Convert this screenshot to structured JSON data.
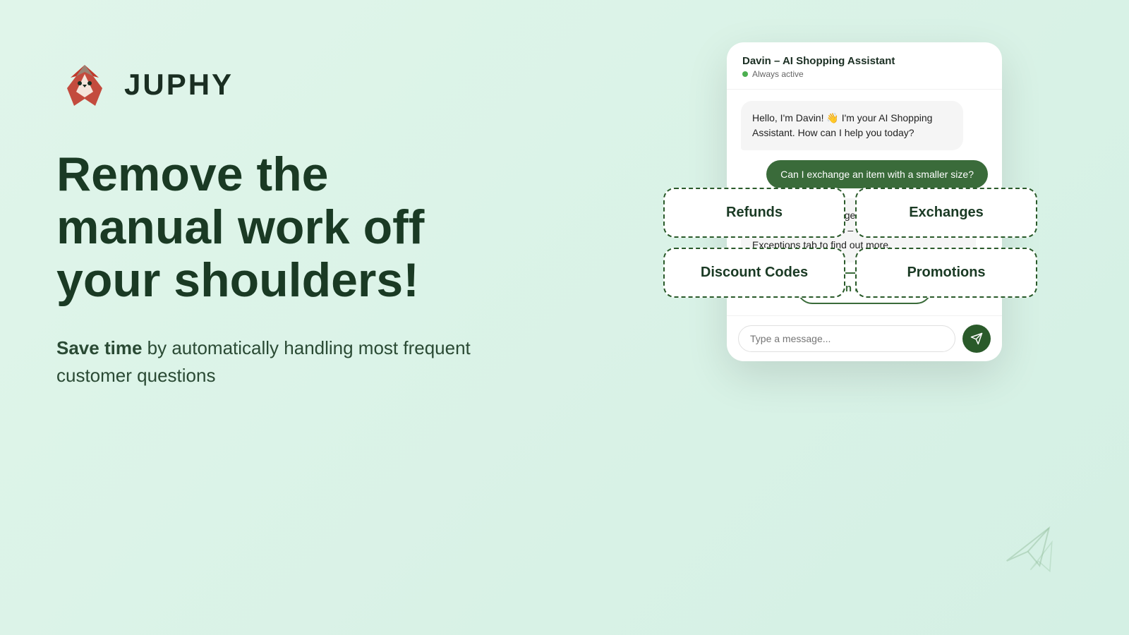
{
  "brand": {
    "name": "JUPHY"
  },
  "headline": {
    "line1": "Remove the",
    "line2": "manual work off",
    "line3": "your shoulders!"
  },
  "subtext": {
    "bold": "Save time",
    "rest": " by automatically handling most frequent customer questions"
  },
  "chat": {
    "header": {
      "title": "Davin – AI Shopping Assistant",
      "status": "Always active"
    },
    "messages": [
      {
        "type": "bot",
        "text": "Hello, I'm Davin! 👋 I'm your AI Shopping Assistant. How can I help you today?"
      },
      {
        "type": "user",
        "text": "Can I exchange an item with a smaller size?"
      },
      {
        "type": "bot",
        "text": "If you wish to exchange an item, this can only be done in our stores – click the Return Exceptions tab to find out more."
      }
    ],
    "return_exceptions_label": "Return Exceptions",
    "quick_replies": [
      {
        "label": "Refunds"
      },
      {
        "label": "Exchanges"
      },
      {
        "label": "Discount Codes"
      },
      {
        "label": "Promotions"
      }
    ],
    "input_placeholder": "Type a message...",
    "send_label": "send"
  }
}
